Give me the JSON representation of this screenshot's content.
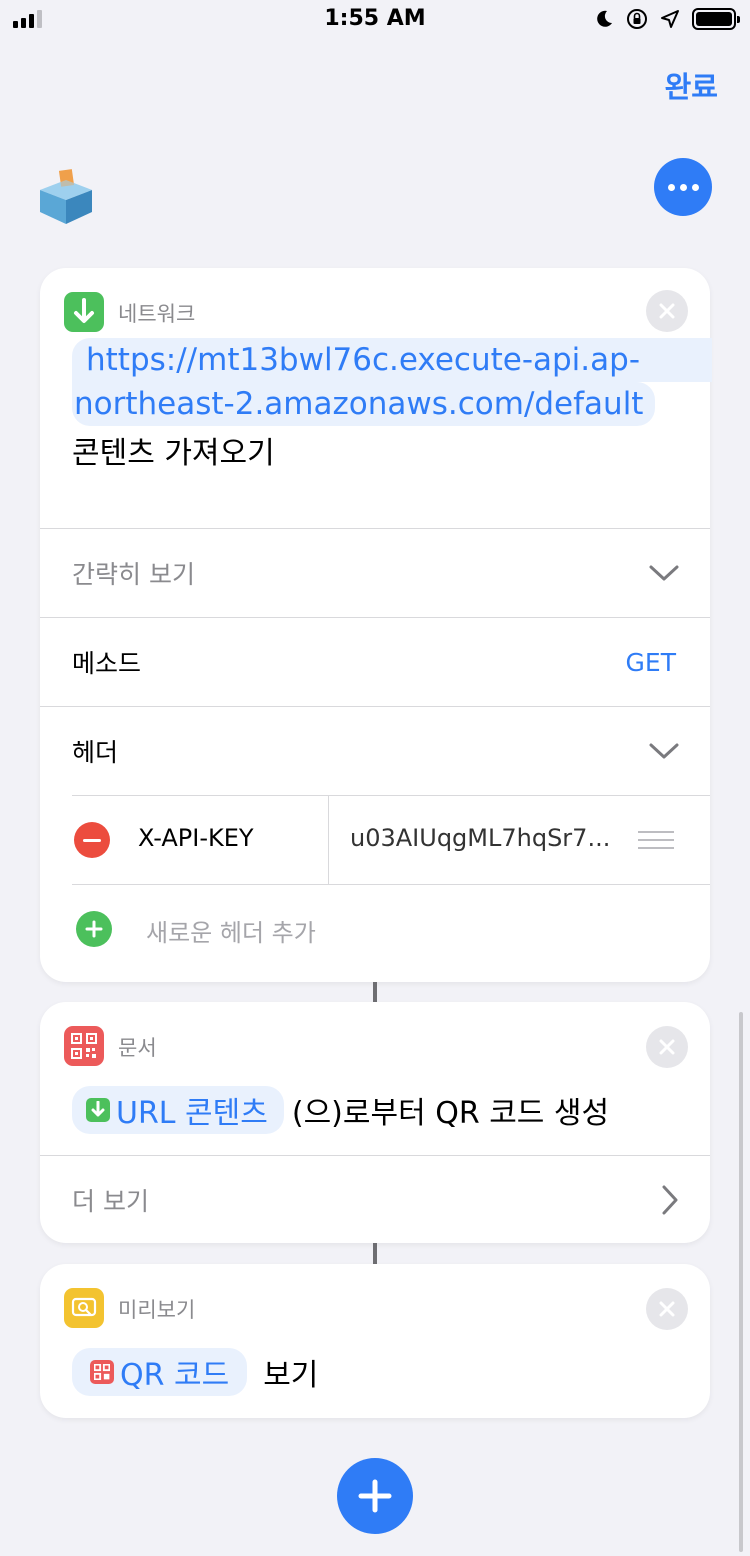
{
  "status_bar": {
    "time": "1:55 AM",
    "icons": [
      "signal-icon",
      "moon-icon",
      "orientation-lock-icon",
      "location-icon",
      "battery-icon"
    ]
  },
  "nav": {
    "done_label": "완료"
  },
  "colors": {
    "accent": "#2f7cf6",
    "network_green": "#4cc05c",
    "document_red": "#ec5a5a",
    "preview_yellow": "#f3c330",
    "remove_red": "#ec4c3e"
  },
  "network_card": {
    "app_label": "네트워크",
    "url_line1": "https://mt13bwl76c.execute-api.ap-",
    "url_line2": "northeast-2.amazonaws.com/default",
    "action_text": "콘텐츠 가져오기",
    "show_less_label": "간략히 보기",
    "method_label": "메소드",
    "method_value": "GET",
    "headers_label": "헤더",
    "header_key": "X-API-KEY",
    "header_value": "u03AIUqgML7hqSr7...",
    "add_header_label": "새로운 헤더 추가"
  },
  "document_card": {
    "app_label": "문서",
    "token_label": "URL 콘텐츠",
    "action_text": "(으)로부터 QR 코드 생성",
    "more_label": "더 보기"
  },
  "preview_card": {
    "app_label": "미리보기",
    "token_label": "QR 코드",
    "action_text": "보기"
  }
}
